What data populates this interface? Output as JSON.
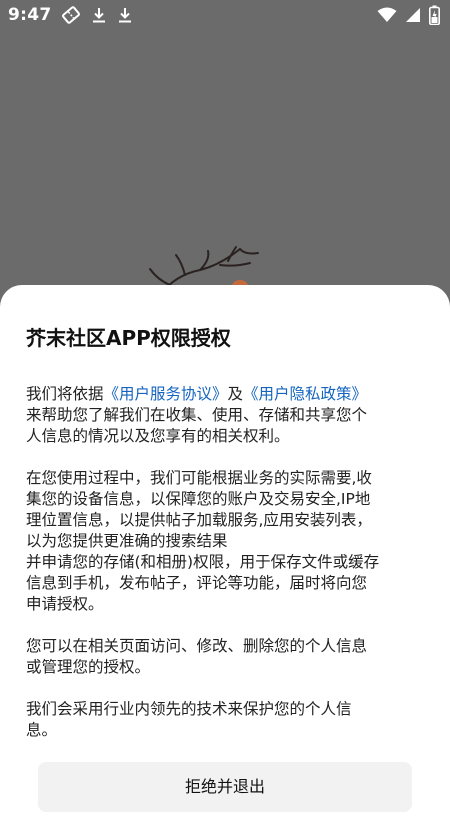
{
  "status_bar": {
    "time": "9:47",
    "left_icons": [
      "ticket-icon",
      "download-icon",
      "download-icon"
    ],
    "right_icons": [
      "wifi-icon",
      "signal-icon",
      "battery-icon"
    ]
  },
  "dialog": {
    "title": "芥末社区APP权限授权",
    "p1": {
      "line1_pre": "我们将依据",
      "link_terms": "《用户服务协议》",
      "line1_mid": "及",
      "link_privacy": "《用户隐私政策》",
      "line2": "来帮助您了解我们在收集、使用、存储和共享您个",
      "line3": "人信息的情况以及您享有的相关权利。"
    },
    "p2": {
      "line1": "在您使用过程中，我们可能根据业务的实际需要,收",
      "line2": "集您的设备信息，以保障您的账户及交易安全,IP地",
      "line3": "理位置信息，以提供帖子加载服务,应用安装列表，",
      "line4": "以为您提供更准确的搜索结果",
      "line5": "并申请您的存储(和相册)权限，用于保存文件或缓存",
      "line6": "信息到手机，发布帖子，评论等功能，届时将向您",
      "line7": "申请授权。"
    },
    "p3": {
      "line1": "您可以在相关页面访问、修改、删除您的个人信息",
      "line2": "或管理您的授权。"
    },
    "p4": {
      "line1": "我们会采用行业内领先的技术来保护您的个人信",
      "line2": "息。"
    },
    "reject_button": "拒绝并退出"
  },
  "colors": {
    "overlay": "#6b6b6b",
    "link": "#1565c0",
    "button_bg": "#f2f2f2"
  }
}
